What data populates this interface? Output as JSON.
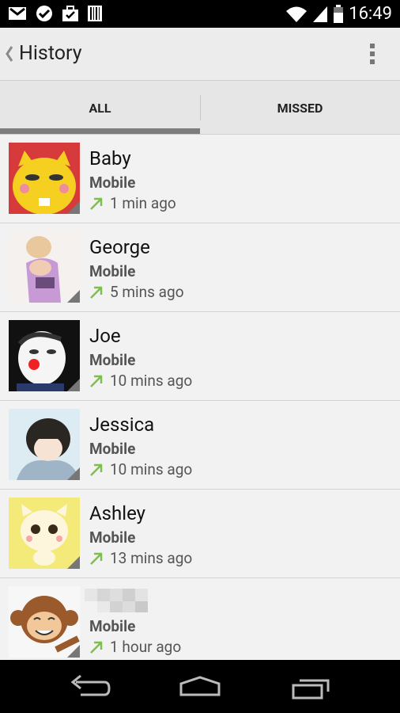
{
  "status_bar": {
    "time": "16:49",
    "icons": [
      "gmail-icon",
      "check-circle-icon",
      "briefcase-icon",
      "barcode-icon",
      "wifi-icon",
      "signal-icon",
      "battery-icon"
    ]
  },
  "action_bar": {
    "title": "History",
    "back_icon": "chevron-left-icon",
    "overflow_icon": "overflow-menu-icon"
  },
  "tabs": [
    {
      "label": "ALL",
      "selected": true
    },
    {
      "label": "MISSED",
      "selected": false
    }
  ],
  "calls": [
    {
      "name": "Baby",
      "type": "Mobile",
      "time_ago": "1 min ago",
      "direction": "outgoing"
    },
    {
      "name": "George",
      "type": "Mobile",
      "time_ago": "5 mins ago",
      "direction": "outgoing"
    },
    {
      "name": "Joe",
      "type": "Mobile",
      "time_ago": "10 mins ago",
      "direction": "outgoing"
    },
    {
      "name": "Jessica",
      "type": "Mobile",
      "time_ago": "10 mins ago",
      "direction": "outgoing"
    },
    {
      "name": "Ashley",
      "type": "Mobile",
      "time_ago": "13 mins ago",
      "direction": "outgoing"
    },
    {
      "name": "",
      "type": "Mobile",
      "time_ago": "1 hour ago",
      "direction": "outgoing"
    }
  ],
  "colors": {
    "outgoing_arrow": "#7cc24a",
    "tab_indicator": "#7d7d7d"
  }
}
